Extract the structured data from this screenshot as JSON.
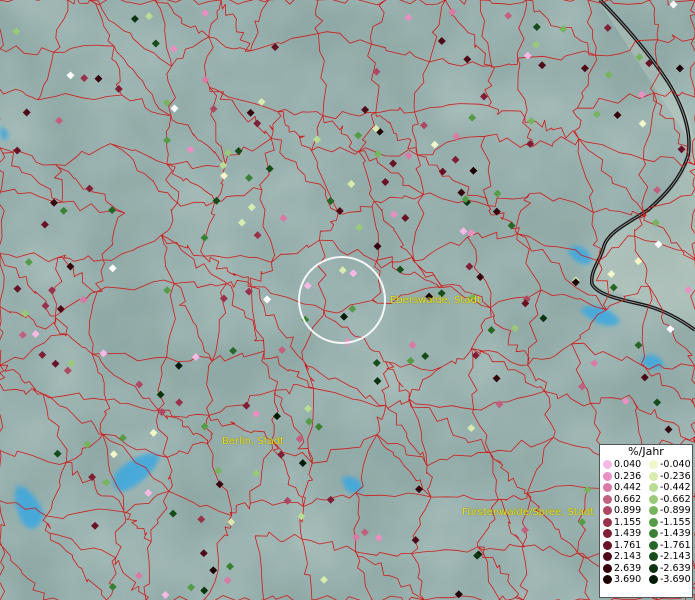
{
  "map": {
    "labels": {
      "eberswalde": "Eberswalde, Stadt",
      "berlin": "Berlin, Stadt",
      "fuerstenwalde": "Fürstenwalde/Spree, Stadt"
    },
    "colors": {
      "background": "#8fa9a6",
      "boundary": "#d01a1a",
      "water": "#3aa8e0",
      "focus_ring": "#ffffff",
      "border_line": "#111111"
    }
  },
  "legend": {
    "title": "%/Jahr",
    "positive": [
      {
        "label": "0.040",
        "color": "#f7b8e6"
      },
      {
        "label": "0.236",
        "color": "#e98fc2"
      },
      {
        "label": "0.442",
        "color": "#d97aa6"
      },
      {
        "label": "0.662",
        "color": "#c2607f"
      },
      {
        "label": "0.899",
        "color": "#ad4862"
      },
      {
        "label": "1.155",
        "color": "#98324b"
      },
      {
        "label": "1.439",
        "color": "#7f1f36"
      },
      {
        "label": "1.761",
        "color": "#671226"
      },
      {
        "label": "2.143",
        "color": "#4e0a19"
      },
      {
        "label": "2.639",
        "color": "#36040e"
      },
      {
        "label": "3.690",
        "color": "#1c0005"
      }
    ],
    "negative": [
      {
        "label": "-0.040",
        "color": "#f2f6c8"
      },
      {
        "label": "-0.236",
        "color": "#d8ecb0"
      },
      {
        "label": "-0.442",
        "color": "#b9dd93"
      },
      {
        "label": "-0.662",
        "color": "#98ca77"
      },
      {
        "label": "-0.899",
        "color": "#76b45d"
      },
      {
        "label": "-1.155",
        "color": "#569b46"
      },
      {
        "label": "-1.439",
        "color": "#3b8134"
      },
      {
        "label": "-1.761",
        "color": "#266626"
      },
      {
        "label": "-2.143",
        "color": "#164c19"
      },
      {
        "label": "-2.639",
        "color": "#0b340f"
      },
      {
        "label": "-3.690",
        "color": "#031b06"
      }
    ]
  }
}
